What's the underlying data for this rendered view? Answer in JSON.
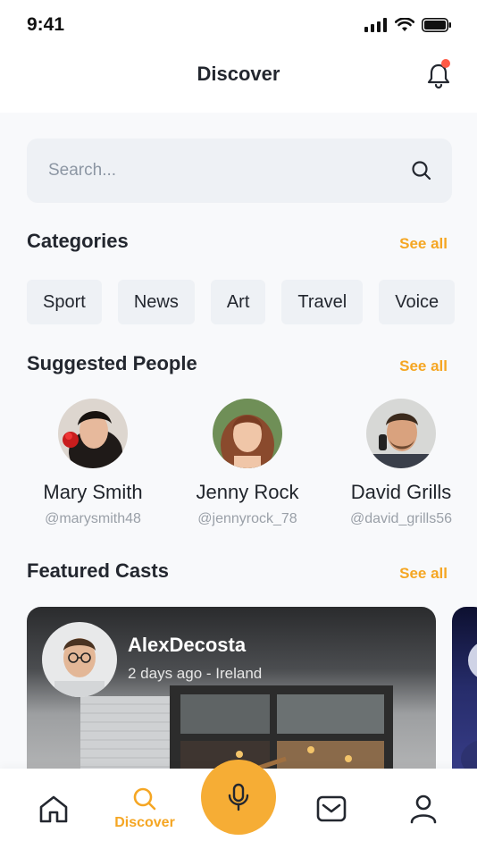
{
  "status_bar": {
    "time": "9:41"
  },
  "header": {
    "title": "Discover"
  },
  "search": {
    "placeholder": "Search..."
  },
  "categories": {
    "title": "Categories",
    "see_all": "See all",
    "items": [
      "Sport",
      "News",
      "Art",
      "Travel",
      "Voice"
    ]
  },
  "suggested_people": {
    "title": "Suggested People",
    "see_all": "See all",
    "people": [
      {
        "name": "Mary Smith",
        "handle": "@marysmith48"
      },
      {
        "name": "Jenny Rock",
        "handle": "@jennyrock_78"
      },
      {
        "name": "David Grills",
        "handle": "@david_grills56"
      }
    ]
  },
  "featured_casts": {
    "title": "Featured Casts",
    "see_all": "See all",
    "casts": [
      {
        "name": "AlexDecosta",
        "meta": "2 days ago - Ireland"
      }
    ]
  },
  "tabbar": {
    "active_label": "Discover",
    "items": [
      "home-icon",
      "search-icon",
      "microphone-icon",
      "mail-icon",
      "profile-icon"
    ]
  },
  "colors": {
    "accent": "#f5a623",
    "notification": "#ff5a45"
  }
}
